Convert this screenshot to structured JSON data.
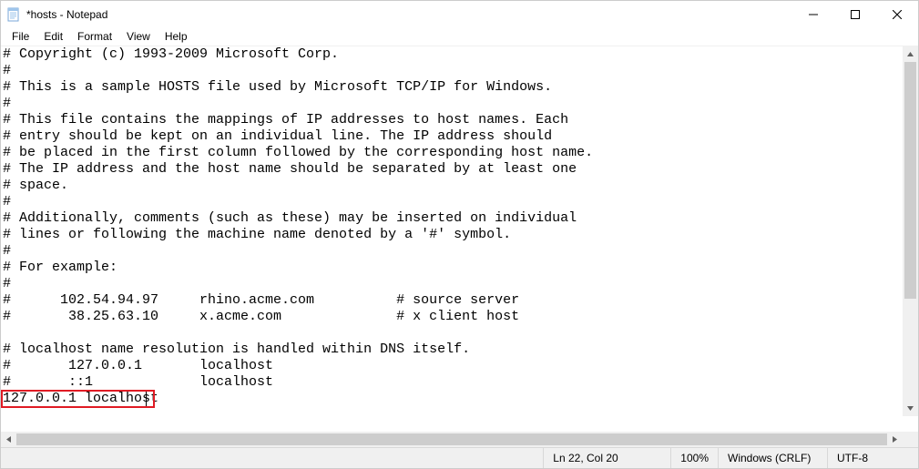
{
  "window": {
    "title": "*hosts - Notepad"
  },
  "menu": {
    "file": "File",
    "edit": "Edit",
    "format": "Format",
    "view": "View",
    "help": "Help"
  },
  "editor": {
    "text": "# Copyright (c) 1993-2009 Microsoft Corp.\n#\n# This is a sample HOSTS file used by Microsoft TCP/IP for Windows.\n#\n# This file contains the mappings of IP addresses to host names. Each\n# entry should be kept on an individual line. The IP address should\n# be placed in the first column followed by the corresponding host name.\n# The IP address and the host name should be separated by at least one\n# space.\n#\n# Additionally, comments (such as these) may be inserted on individual\n# lines or following the machine name denoted by a '#' symbol.\n#\n# For example:\n#\n#      102.54.94.97     rhino.acme.com          # source server\n#       38.25.63.10     x.acme.com              # x client host\n\n# localhost name resolution is handled within DNS itself.\n#\t127.0.0.1       localhost\n#\t::1             localhost\n127.0.0.1 localhost"
  },
  "highlight": {
    "line_text": "127.0.0.1 localhost"
  },
  "status": {
    "position": "Ln 22, Col 20",
    "zoom": "100%",
    "eol": "Windows (CRLF)",
    "encoding": "UTF-8"
  }
}
